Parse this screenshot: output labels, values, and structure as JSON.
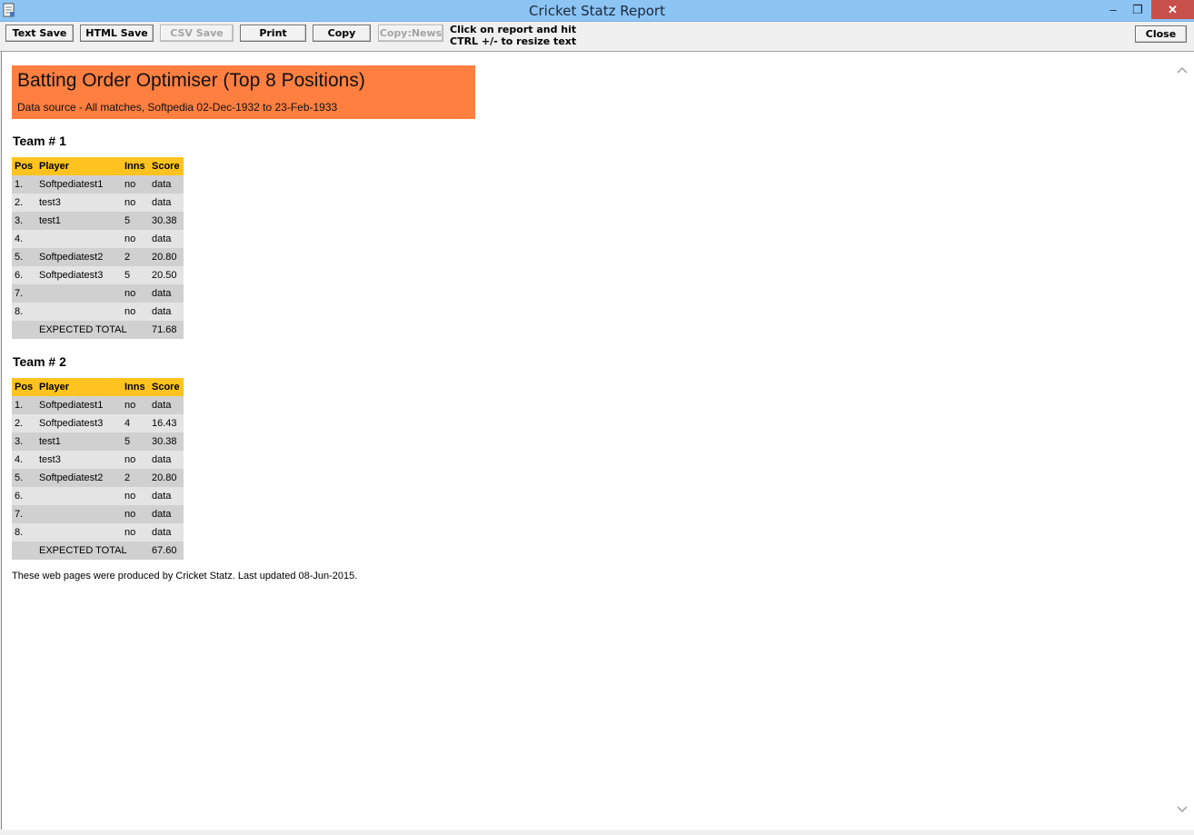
{
  "window": {
    "title": "Cricket Statz Report",
    "minimize_glyph": "–",
    "maximize_glyph": "❐",
    "close_glyph": "✕"
  },
  "toolbar": {
    "text_save": "Text Save",
    "html_save": "HTML Save",
    "csv_save": "CSV Save",
    "print": "Print",
    "copy": "Copy",
    "copy_news": "Copy:News",
    "hint_line1": "Click on report and hit",
    "hint_line2": "CTRL +/- to resize text",
    "close": "Close"
  },
  "report": {
    "title": "Batting Order Optimiser (Top 8 Positions)",
    "subtitle": "Data source - All matches, Softpedia 02-Dec-1932 to 23-Feb-1933",
    "columns": [
      "Pos",
      "Player",
      "Inns",
      "Score"
    ],
    "teams": [
      {
        "heading": "Team # 1",
        "rows": [
          {
            "pos": "1.",
            "player": "Softpediatest1",
            "inns": "no",
            "score": "data"
          },
          {
            "pos": "2.",
            "player": "test3",
            "inns": "no",
            "score": "data"
          },
          {
            "pos": "3.",
            "player": "test1",
            "inns": "5",
            "score": "30.38"
          },
          {
            "pos": "4.",
            "player": "",
            "inns": "no",
            "score": "data"
          },
          {
            "pos": "5.",
            "player": "Softpediatest2",
            "inns": "2",
            "score": "20.80"
          },
          {
            "pos": "6.",
            "player": "Softpediatest3",
            "inns": "5",
            "score": "20.50"
          },
          {
            "pos": "7.",
            "player": "",
            "inns": "no",
            "score": "data"
          },
          {
            "pos": "8.",
            "player": "",
            "inns": "no",
            "score": "data"
          }
        ],
        "total_label": "EXPECTED TOTAL",
        "total_value": "71.68"
      },
      {
        "heading": "Team # 2",
        "rows": [
          {
            "pos": "1.",
            "player": "Softpediatest1",
            "inns": "no",
            "score": "data"
          },
          {
            "pos": "2.",
            "player": "Softpediatest3",
            "inns": "4",
            "score": "16.43"
          },
          {
            "pos": "3.",
            "player": "test1",
            "inns": "5",
            "score": "30.38"
          },
          {
            "pos": "4.",
            "player": "test3",
            "inns": "no",
            "score": "data"
          },
          {
            "pos": "5.",
            "player": "Softpediatest2",
            "inns": "2",
            "score": "20.80"
          },
          {
            "pos": "6.",
            "player": "",
            "inns": "no",
            "score": "data"
          },
          {
            "pos": "7.",
            "player": "",
            "inns": "no",
            "score": "data"
          },
          {
            "pos": "8.",
            "player": "",
            "inns": "no",
            "score": "data"
          }
        ],
        "total_label": "EXPECTED TOTAL",
        "total_value": "67.60"
      }
    ],
    "footer": "These web pages were produced by Cricket Statz. Last updated 08-Jun-2015."
  },
  "colors": {
    "titlebar": "#8cc4f4",
    "banner": "#ff7f40",
    "header_row": "#ffc31f",
    "row_dark": "#d0d0d0",
    "row_light": "#e4e4e4",
    "close_button": "#c7504b"
  },
  "icons": {
    "app": "report-document-icon",
    "scroll_up": "chevron-up-icon",
    "scroll_down": "chevron-down-icon"
  }
}
